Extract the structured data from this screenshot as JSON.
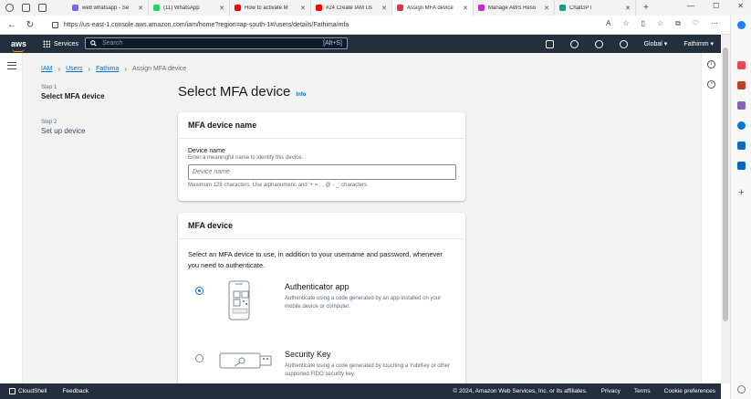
{
  "browser": {
    "tabs": [
      {
        "title": "web whatsapp - Se",
        "fav": "#7b61ff",
        "active": false
      },
      {
        "title": "(11) WhatsApp",
        "fav": "#25d366",
        "active": false
      },
      {
        "title": "How to activate M",
        "fav": "#ff0000",
        "active": false
      },
      {
        "title": "#24 Create IAM Us",
        "fav": "#ff0000",
        "active": false
      },
      {
        "title": "Assign MFA device",
        "fav": "#dd344c",
        "active": true
      },
      {
        "title": "Manage AWS Reso",
        "fav": "#c925d1",
        "active": false
      },
      {
        "title": "ChatGPT",
        "fav": "#10a37f",
        "active": false
      }
    ],
    "new_tab": "+",
    "url": "https://us-east-1.console.aws.amazon.com/iam/home?region=ap-south-1#/users/details/Fathima/mfa"
  },
  "awsnav": {
    "logo": "aws",
    "services": "Services",
    "search_placeholder": "Search",
    "search_shortcut": "[Alt+S]",
    "region": "Global ▾",
    "user": "Fathimm ▾"
  },
  "breadcrumb": {
    "items": [
      "IAM",
      "Users",
      "Fathima"
    ],
    "current": "Assign MFA device"
  },
  "steps": [
    {
      "num": "Step 1",
      "label": "Select MFA device"
    },
    {
      "num": "Step 2",
      "label": "Set up device"
    }
  ],
  "page": {
    "title": "Select MFA device",
    "info": "Info"
  },
  "name_card": {
    "heading": "MFA device name",
    "field_label": "Device name",
    "field_desc": "Enter a meaningful name to identify this device.",
    "placeholder": "Device name",
    "hint": "Maximum 128 characters. Use alphanumeric and '+ = , . @ - _' characters."
  },
  "device_card": {
    "heading": "MFA device",
    "intro": "Select an MFA device to use, in addition to your username and password, whenever you need to authenticate.",
    "options": [
      {
        "title": "Authenticator app",
        "desc": "Authenticate using a code generated by an app installed on your mobile device or computer.",
        "selected": true
      },
      {
        "title": "Security Key",
        "desc": "Authenticate using a code generated by touching a YubiKey or other supported FIDO security key.",
        "selected": false
      }
    ]
  },
  "footer": {
    "cloudshell": "CloudShell",
    "feedback": "Feedback",
    "copyright": "© 2024, Amazon Web Services, Inc. or its affiliates.",
    "privacy": "Privacy",
    "terms": "Terms",
    "cookies": "Cookie preferences"
  },
  "colors": {
    "aws_nav": "#232f3e",
    "link": "#0972d3",
    "aws_orange": "#ff9900"
  }
}
